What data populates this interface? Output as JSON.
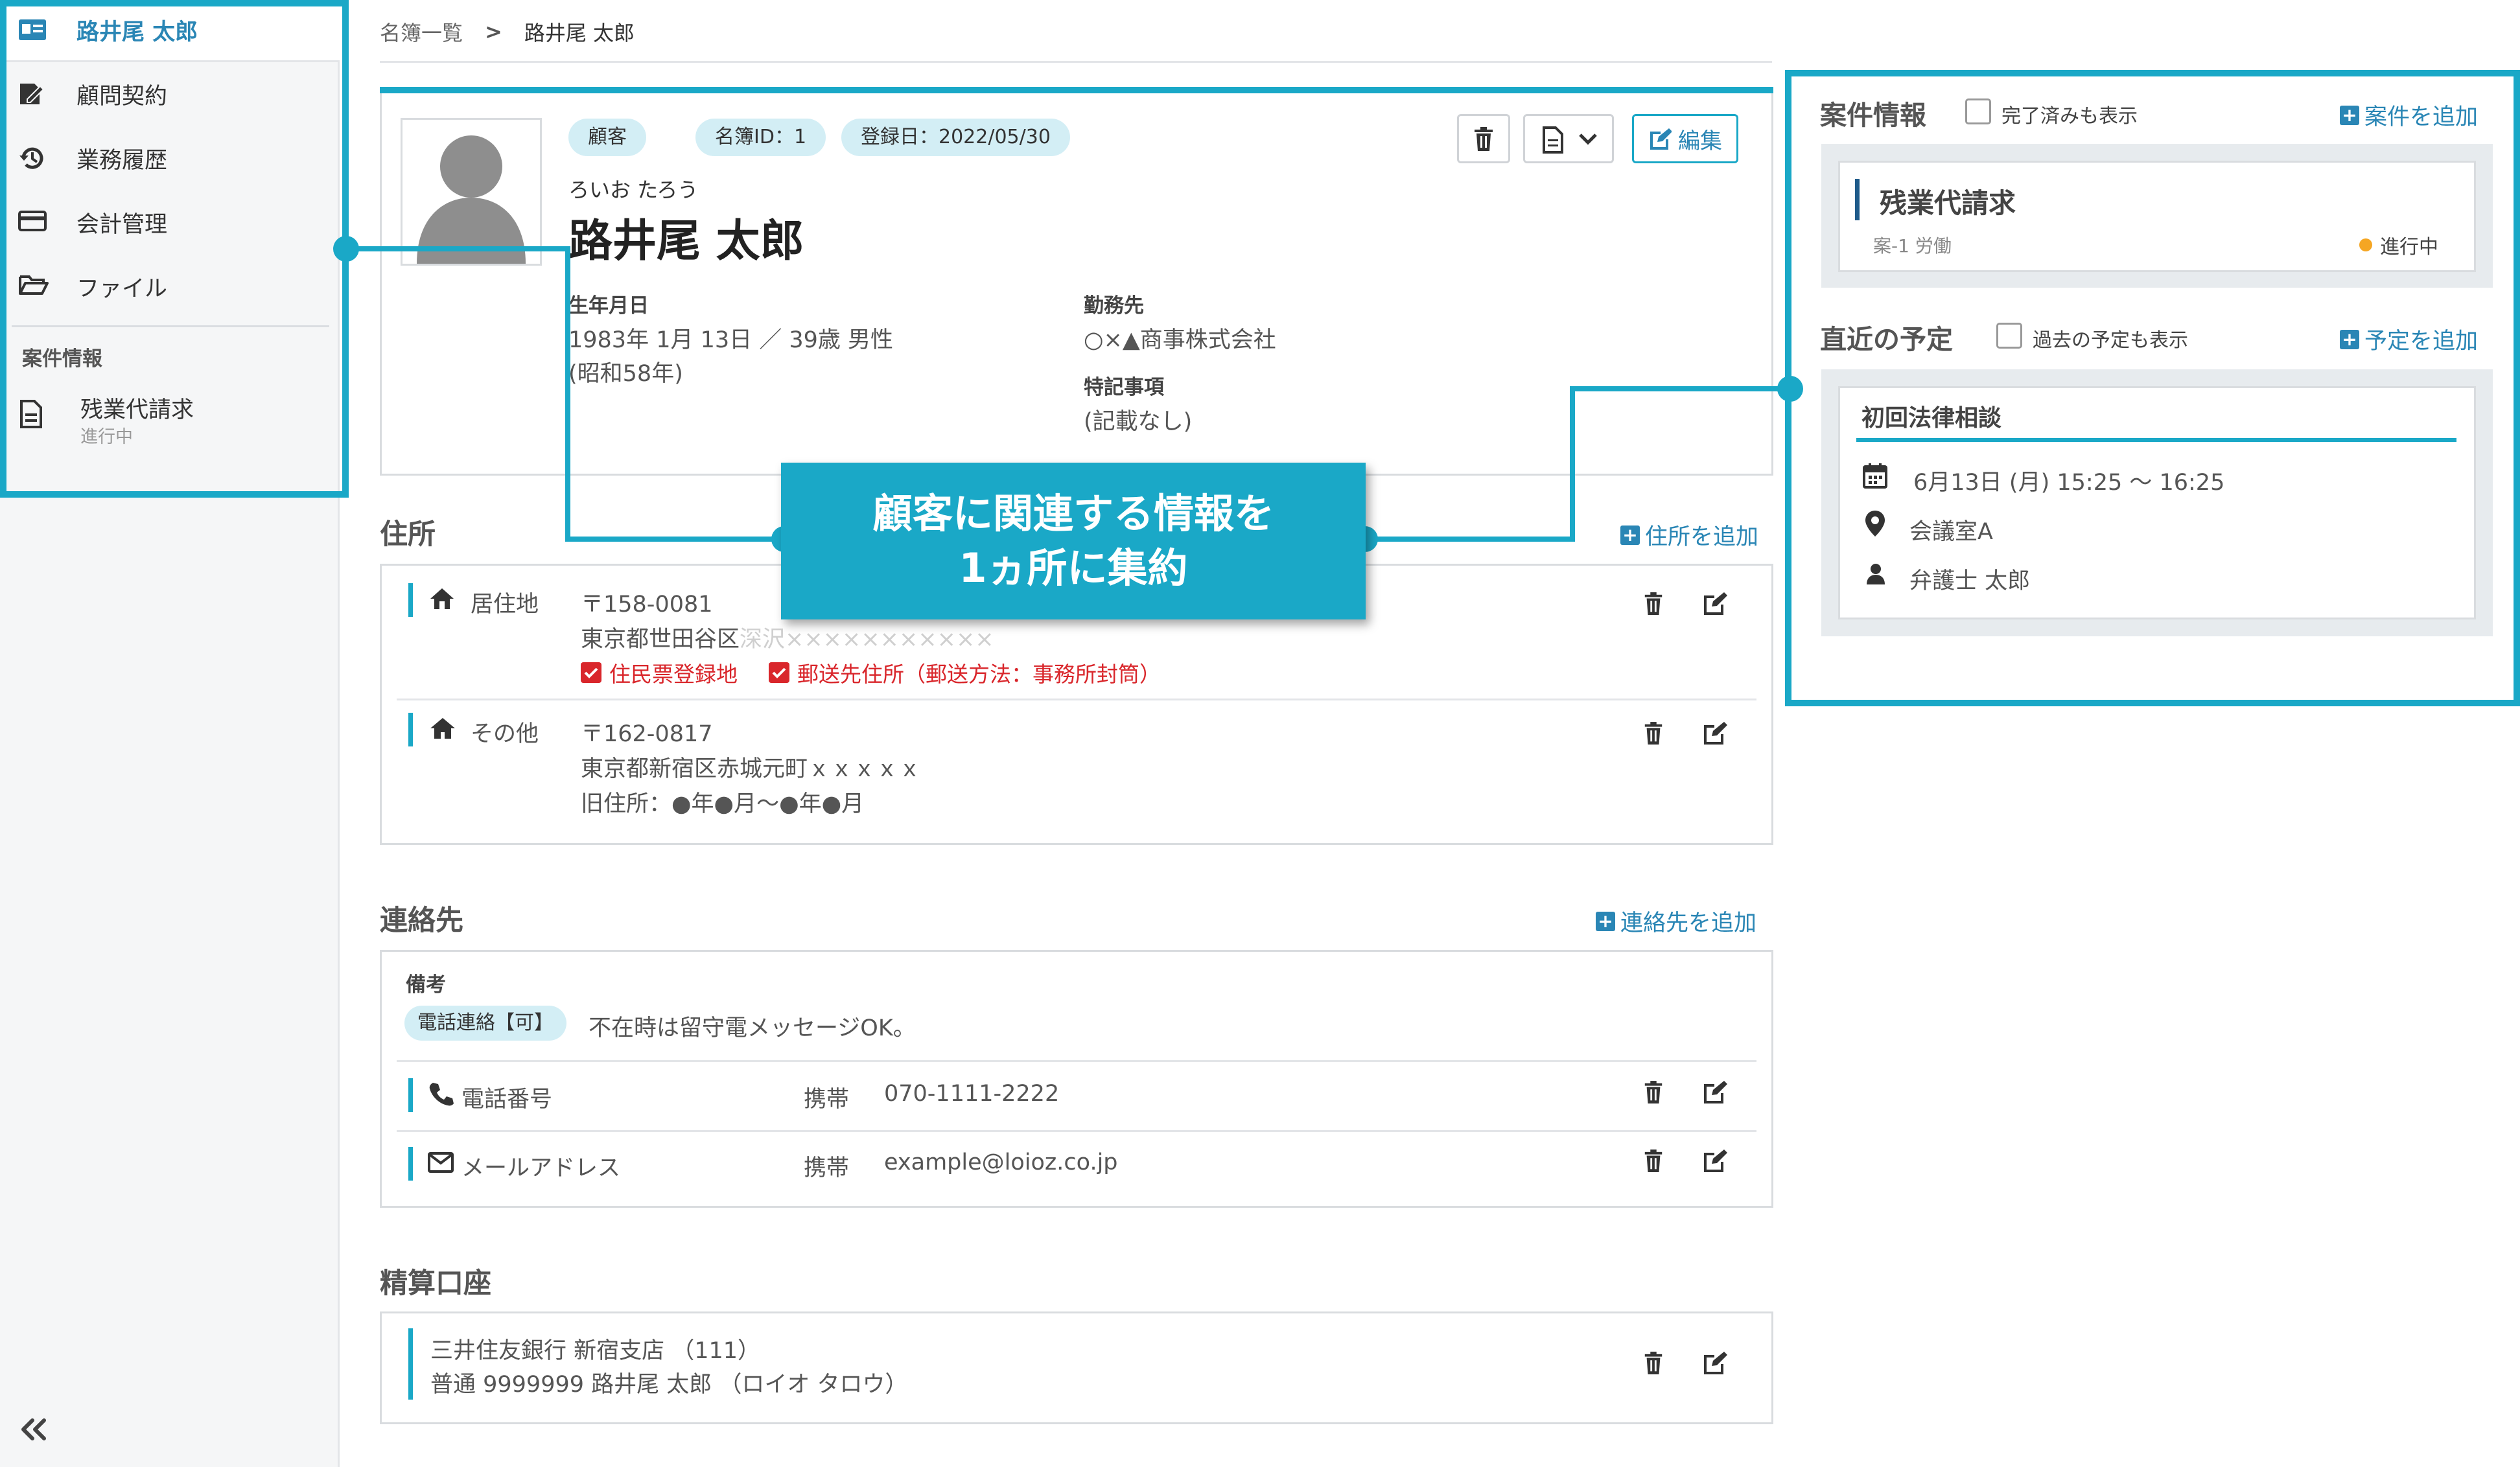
{
  "sidebar": {
    "items": [
      {
        "label": "路井尾 太郎",
        "icon": "id-card-icon"
      },
      {
        "label": "顧問契約",
        "icon": "contract-sign-icon"
      },
      {
        "label": "業務履歴",
        "icon": "history-icon"
      },
      {
        "label": "会計管理",
        "icon": "credit-card-icon"
      },
      {
        "label": "ファイル",
        "icon": "folder-open-icon"
      }
    ],
    "section_title": "案件情報",
    "case": {
      "label": "残業代請求",
      "status": "進行中",
      "icon": "document-icon"
    },
    "collapse_icon": "double-chevron-left-icon"
  },
  "breadcrumb": {
    "parent": "名簿一覧",
    "separator": ">",
    "current": "路井尾 太郎"
  },
  "profile": {
    "tags": [
      "顧客",
      "名簿ID：1",
      "登録日：2022/05/30"
    ],
    "kana": "ろいお たろう",
    "name": "路井尾 太郎",
    "edit_label": "編集",
    "birth_label": "生年月日",
    "birth_line1": "1983年 1月 13日 ／ 39歳 男性",
    "birth_line2": "(昭和58年)",
    "work_label": "勤務先",
    "work_value": "○×▲商事株式会社",
    "notes_label": "特記事項",
    "notes_value": "(記載なし)"
  },
  "address": {
    "title": "住所",
    "add_label": "住所を追加",
    "items": [
      {
        "type": "居住地",
        "postal": "〒158-0081",
        "line": "東京都世田谷区",
        "line_faded": "深沢×××××××××××",
        "flags": [
          "住民票登録地",
          "郵送先住所（郵送方法：事務所封筒）"
        ]
      },
      {
        "type": "その他",
        "postal": "〒162-0817",
        "line": "東京都新宿区赤城元町ｘｘｘｘｘ",
        "old": "旧住所：●年●月～●年●月"
      }
    ]
  },
  "contacts": {
    "title": "連絡先",
    "add_label": "連絡先を追加",
    "note_label": "備考",
    "note_tag": "電話連絡【可】",
    "note_text": "不在時は留守電メッセージOK。",
    "items": [
      {
        "label": "電話番号",
        "kind": "携帯",
        "value": "070-1111-2222"
      },
      {
        "label": "メールアドレス",
        "kind": "携帯",
        "value": "example@loioz.co.jp"
      }
    ]
  },
  "bank": {
    "title": "精算口座",
    "line1": "三井住友銀行 新宿支店 （111）",
    "line2": "普通 9999999 路井尾 太郎 （ロイオ タロウ）"
  },
  "cases": {
    "title": "案件情報",
    "checkbox_label": "完了済みも表示",
    "add_label": "案件を追加",
    "card_title": "残業代請求",
    "card_sub": "案-1 労働",
    "card_status": "進行中"
  },
  "schedule": {
    "title": "直近の予定",
    "checkbox_label": "過去の予定も表示",
    "add_label": "予定を追加",
    "event_title": "初回法律相談",
    "datetime": "6月13日 (月) 15:25 ～ 16:25",
    "place": "会議室A",
    "person": "弁護士 太郎"
  },
  "callout": {
    "line1": "顧客に関連する情報を",
    "line2": "1ヵ所に集約"
  },
  "colors": {
    "accent": "#1aa8c7",
    "link": "#2a86b5",
    "status_dot": "#f5a623",
    "flag_red": "#d9262b"
  }
}
